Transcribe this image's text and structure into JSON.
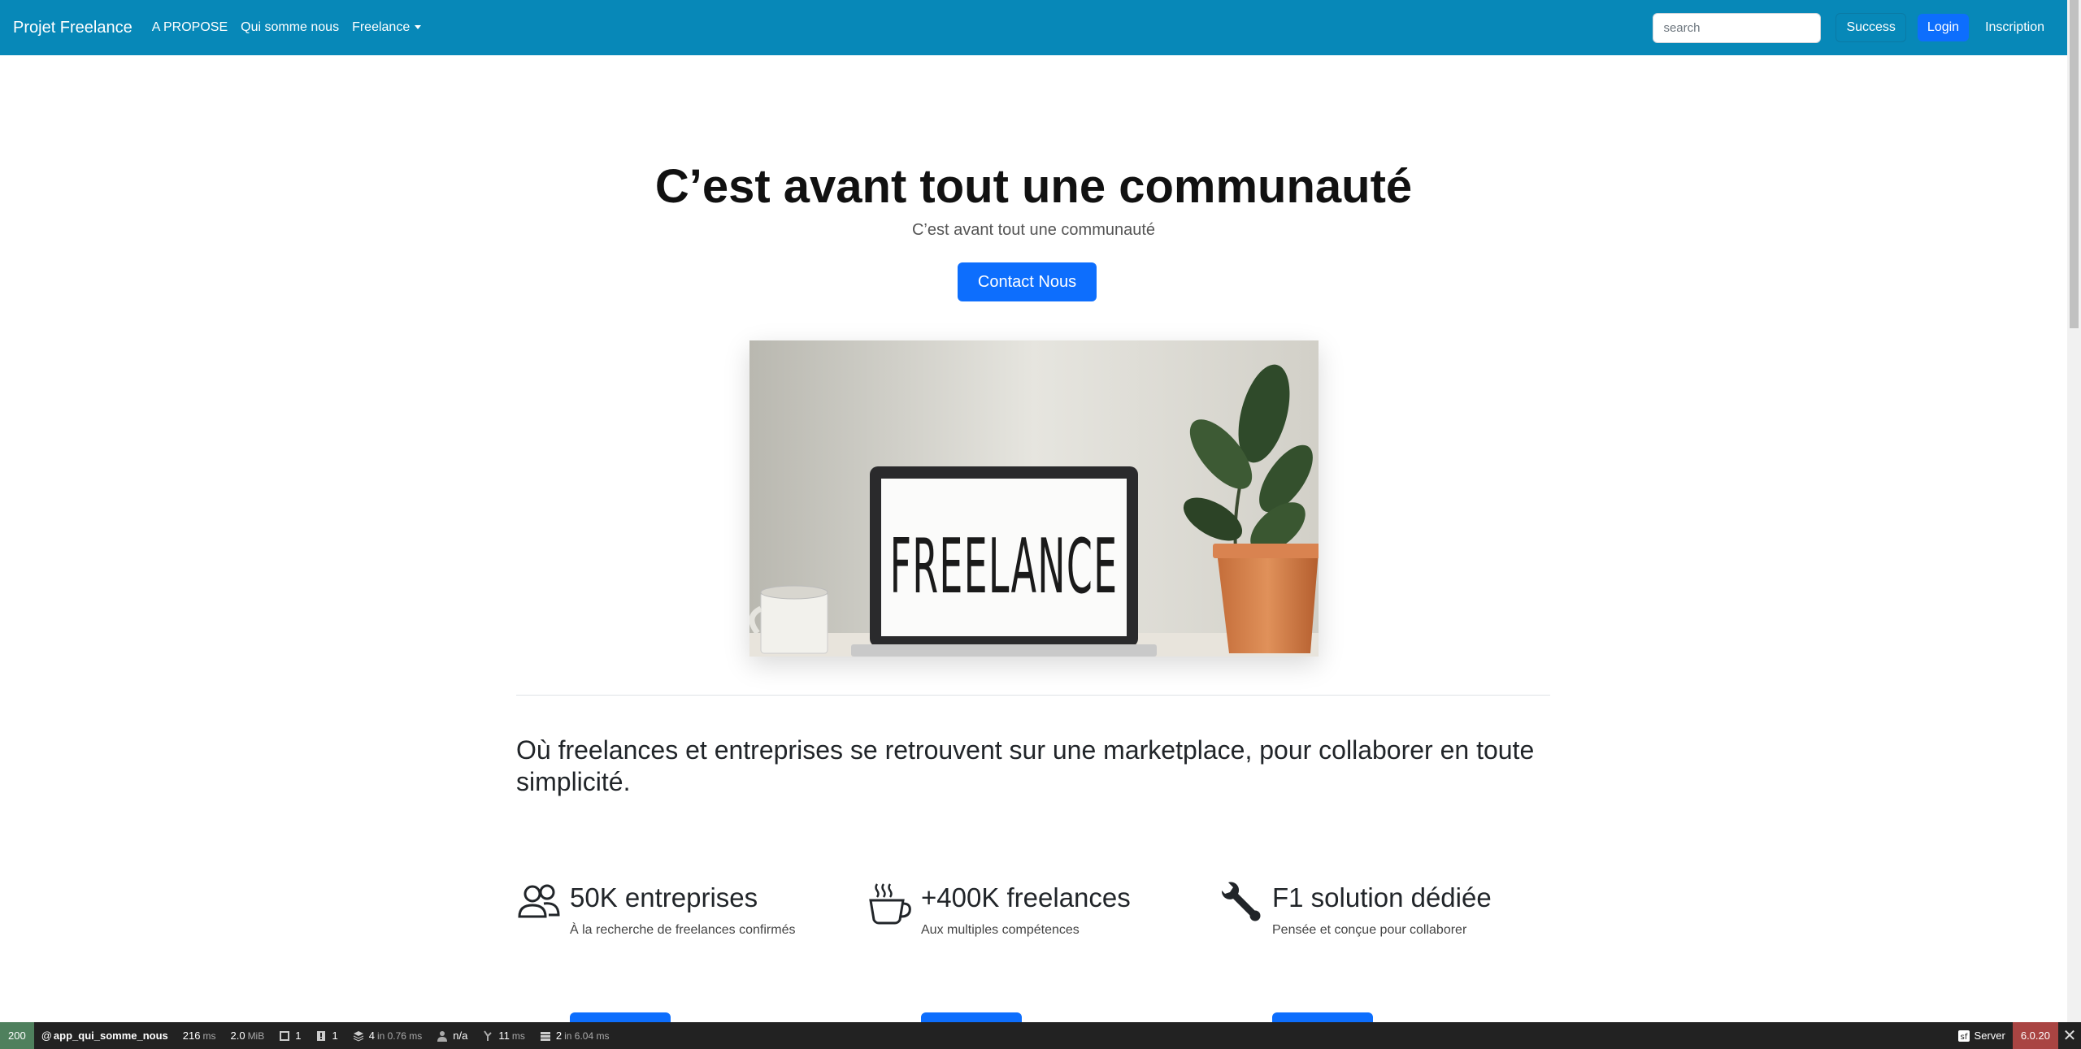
{
  "navbar": {
    "brand": "Projet Freelance",
    "links": [
      "A PROPOSE",
      "Qui somme nous",
      "Freelance"
    ],
    "search_placeholder": "search",
    "success_label": "Success",
    "login_label": "Login",
    "register_label": "Inscription"
  },
  "hero": {
    "title": "C’est avant tout une communauté",
    "subtitle": "C’est avant tout une communauté",
    "contact_label": "Contact Nous",
    "image_text": "FREELANCE"
  },
  "lead": "Où freelances et entreprises se retrouvent sur une marketplace, pour collaborer en toute simplicité.",
  "features": [
    {
      "icon": "people-icon",
      "title": "50K entreprises",
      "desc": "À la recherche de freelances confirmés"
    },
    {
      "icon": "cup-hot-icon",
      "title": "+400K freelances",
      "desc": "Aux multiples compétences"
    },
    {
      "icon": "wrench-icon",
      "title": "F1 solution dédiée",
      "desc": "Pensée et conçue pour collaborer"
    }
  ],
  "debug_toolbar": {
    "status": "200",
    "route": "app_qui_somme_nous",
    "time_value": "216",
    "time_unit": "ms",
    "memory_value": "2.0",
    "memory_unit": "MiB",
    "forms": "1",
    "logs": "1",
    "cache": "4",
    "cache_suffix": "in 0.76 ms",
    "user": "n/a",
    "events_value": "11",
    "events_unit": "ms",
    "db": "2",
    "db_suffix": "in 6.04 ms",
    "server_label": "Server",
    "version": "6.0.20"
  },
  "colors": {
    "navbar_bg": "#0788b8",
    "primary": "#0d6efd",
    "toolbar_bg": "#222222",
    "status_green": "#4f805d",
    "version_red": "#a94442"
  }
}
